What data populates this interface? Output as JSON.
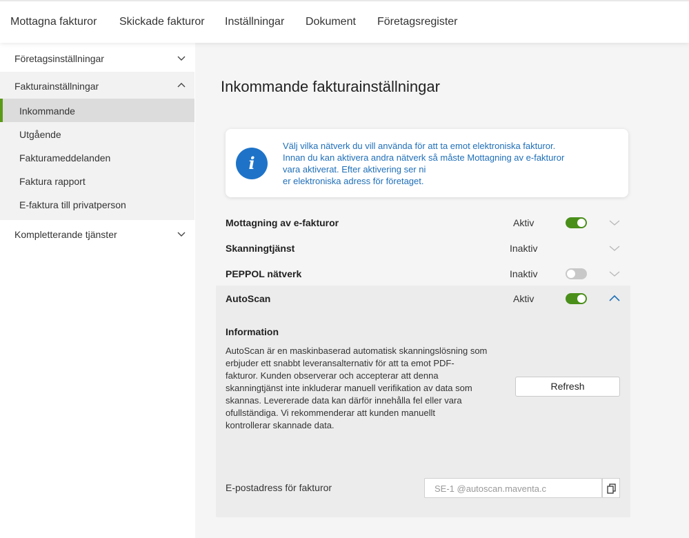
{
  "topnav": {
    "items": [
      "Mottagna fakturor",
      "Skickade fakturor",
      "Inställningar",
      "Dokument",
      "Företagsregister"
    ]
  },
  "sidebar": {
    "group1": "Företagsinställningar",
    "group2": "Fakturainställningar",
    "sub": [
      "Inkommande",
      "Utgående",
      "Fakturameddelanden",
      "Faktura rapport",
      "E-faktura till privatperson"
    ],
    "group3": "Kompletterande tjänster"
  },
  "page": {
    "title": "Inkommande fakturainställningar"
  },
  "info": {
    "lines": [
      "Välj vilka nätverk du vill använda för att ta emot elektroniska fakturor.",
      "Innan du kan aktivera andra nätverk så måste Mottagning av e-fakturor",
      "vara aktiverat. Efter aktivering ser ni",
      "er elektroniska adress för företaget."
    ]
  },
  "services": [
    {
      "name": "Mottagning av e-fakturor",
      "status": "Aktiv"
    },
    {
      "name": "Skanningtjänst",
      "status": "Inaktiv"
    },
    {
      "name": "PEPPOL nätverk",
      "status": "Inaktiv"
    }
  ],
  "autoscan": {
    "name": "AutoScan",
    "status": "Aktiv",
    "info_title": "Information",
    "desc_lines": [
      "AutoScan är en maskinbaserad automatisk skanningslösning som",
      "erbjuder ett snabbt leveransalternativ för att ta emot PDF-",
      "fakturor. Kunden observerar och accepterar att denna",
      "skanningtjänst inte inkluderar manuell verifikation av data som",
      "skannas. Levererade data kan därför innehålla fel eller vara",
      "ofullständiga. Vi rekommenderar att kunden manuellt",
      "kontrollerar skannade data."
    ],
    "refresh_label": "Refresh",
    "email_label": "E-postadress för fakturor",
    "email_value": "SE-1          @autoscan.maventa.c"
  },
  "colors": {
    "accent_green": "#4a8f1a",
    "info_blue": "#1e73c8"
  }
}
